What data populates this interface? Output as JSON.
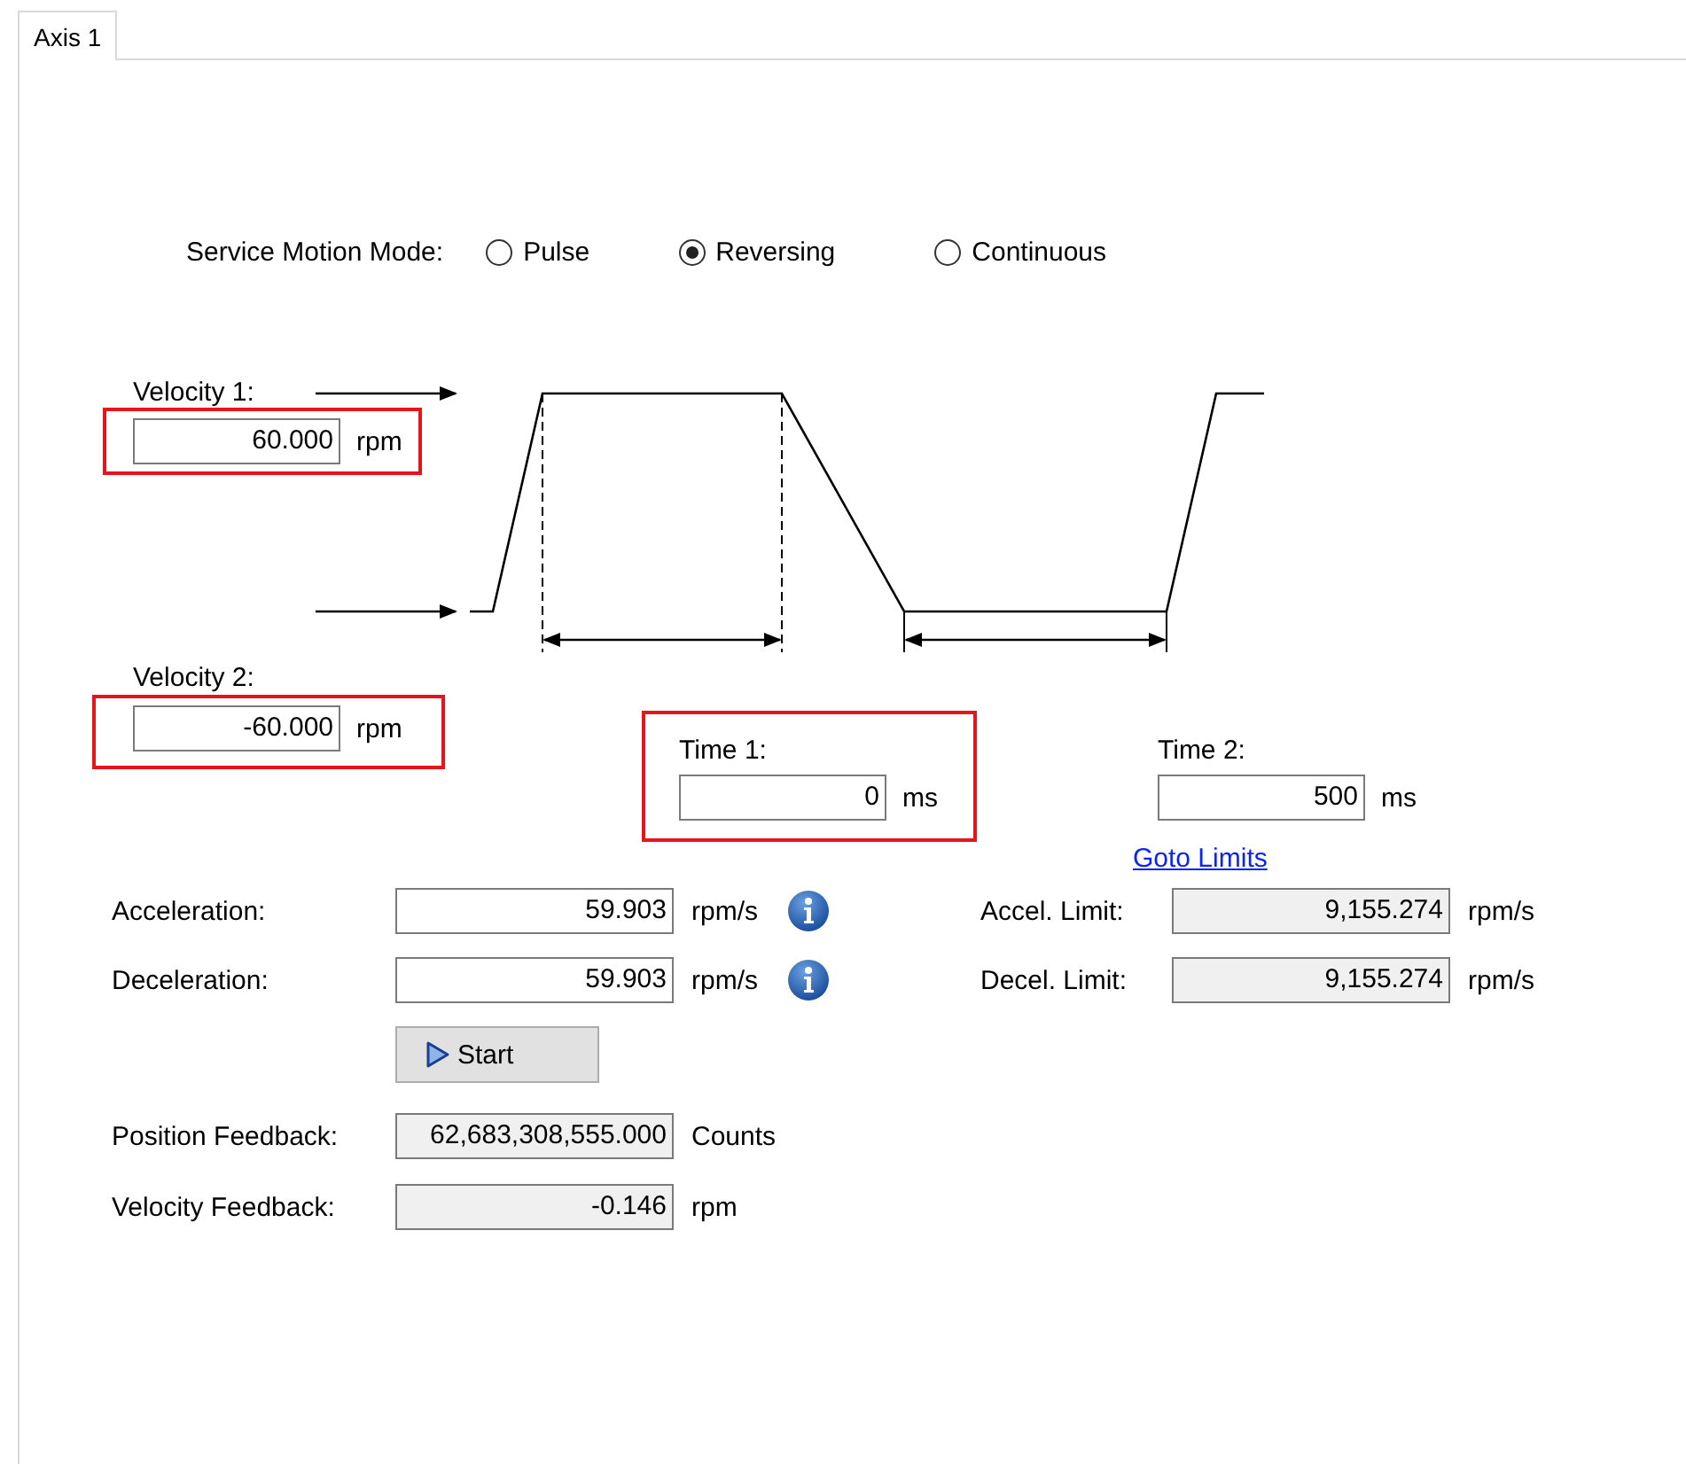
{
  "tabs": [
    {
      "label": "Axis 1",
      "selected": true
    }
  ],
  "motion_mode": {
    "label": "Service Motion Mode:",
    "options": [
      {
        "label": "Pulse",
        "selected": false
      },
      {
        "label": "Reversing",
        "selected": true
      },
      {
        "label": "Continuous",
        "selected": false
      }
    ]
  },
  "velocity_1": {
    "label": "Velocity 1:",
    "value": "60.000",
    "unit": "rpm",
    "highlighted": true
  },
  "velocity_2": {
    "label": "Velocity 2:",
    "value": "-60.000",
    "unit": "rpm",
    "highlighted": true
  },
  "time_1": {
    "label": "Time 1:",
    "value": "0",
    "unit": "ms",
    "highlighted": true
  },
  "time_2": {
    "label": "Time 2:",
    "value": "500",
    "unit": "ms",
    "highlighted": false
  },
  "goto_limits": "Goto Limits",
  "ramps": [
    {
      "label": "Acceleration:",
      "value": "59.903",
      "unit": "rpm/s",
      "info": true,
      "limit_label": "Accel. Limit:",
      "limit_value": "9,155.274",
      "limit_unit": "rpm/s"
    },
    {
      "label": "Deceleration:",
      "value": "59.903",
      "unit": "rpm/s",
      "info": true,
      "limit_label": "Decel. Limit:",
      "limit_value": "9,155.274",
      "limit_unit": "rpm/s"
    }
  ],
  "start_button": {
    "label": "Start"
  },
  "feedback": [
    {
      "label": "Position Feedback:",
      "value": "62,683,308,555.000",
      "unit": "Counts",
      "readonly": true
    },
    {
      "label": "Velocity Feedback:",
      "value": "-0.146",
      "unit": "rpm",
      "readonly": true
    }
  ]
}
